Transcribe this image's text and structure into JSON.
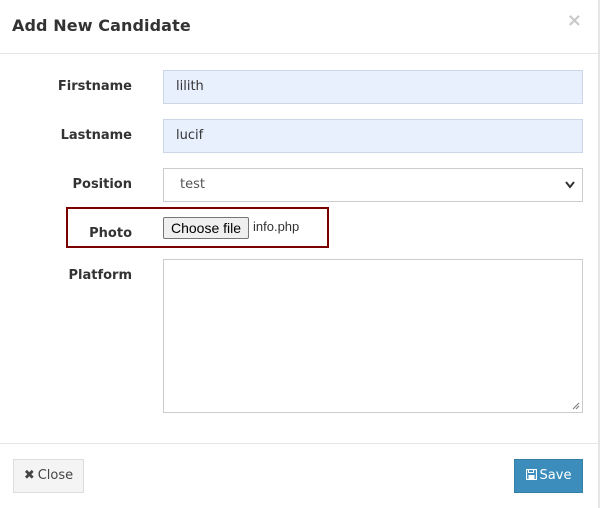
{
  "modal": {
    "title": "Add New Candidate",
    "close_glyph": "×"
  },
  "form": {
    "firstname": {
      "label": "Firstname",
      "value": "lilith"
    },
    "lastname": {
      "label": "Lastname",
      "value": "lucif"
    },
    "position": {
      "label": "Position",
      "selected": "test"
    },
    "photo": {
      "label": "Photo",
      "button_label": "Choose file",
      "file_name": "info.php"
    },
    "platform": {
      "label": "Platform",
      "value": ""
    }
  },
  "footer": {
    "close_label": "Close",
    "save_label": "Save"
  },
  "icons": {
    "close_button_icon": "times-icon",
    "save_button_icon": "floppy-disk-icon",
    "select_chevron": "chevron-down-icon"
  },
  "colors": {
    "save_button": "#3c8dbc",
    "autofill_input": "#e8f0fe",
    "highlight_border": "#7a0000"
  }
}
